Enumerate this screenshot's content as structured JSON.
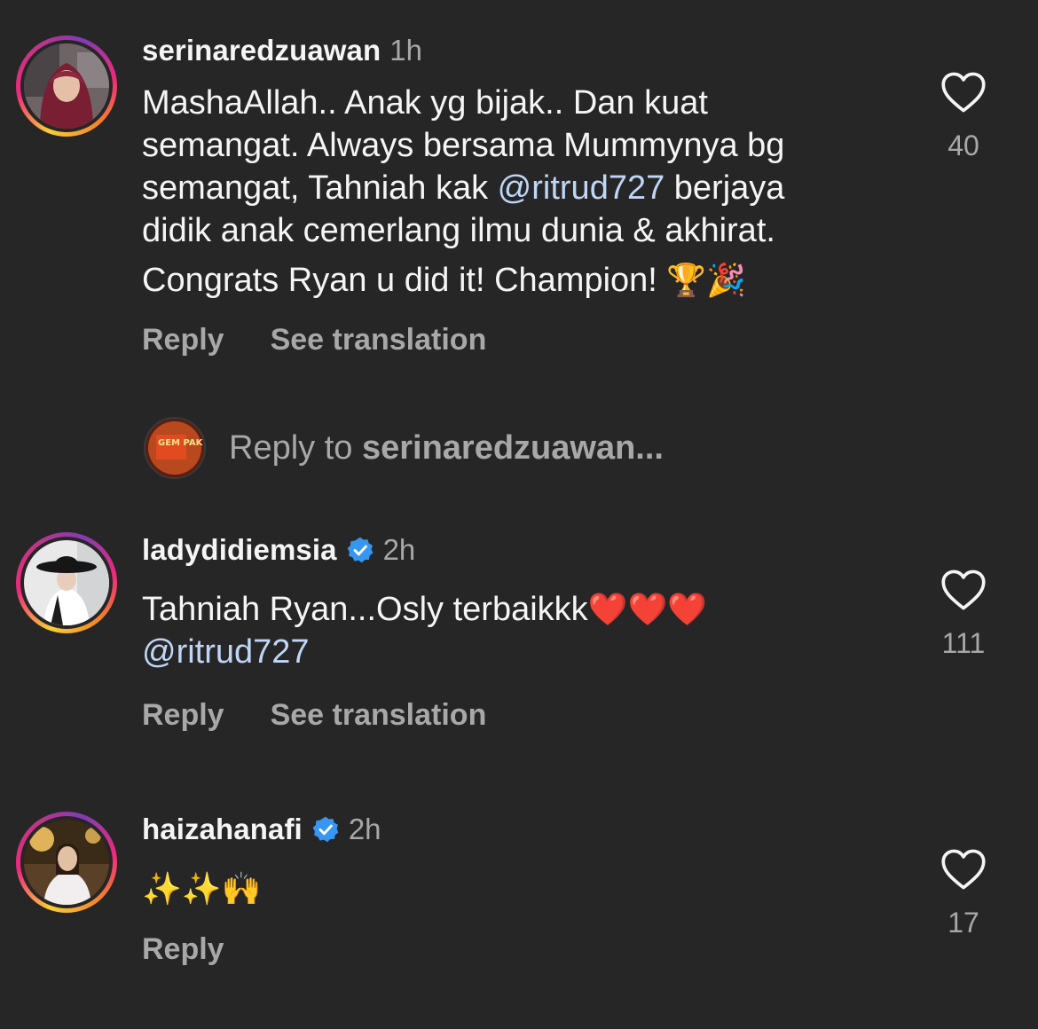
{
  "comments": [
    {
      "username": "serinaredzuawan",
      "verified": false,
      "time": "1h",
      "lines": [
        "MashaAllah.. Anak yg bijak.. Dan kuat",
        "semangat. Always bersama Mummynya bg",
        "semangat, Tahniah kak ",
        "didik anak cemerlang ilmu dunia & akhirat.",
        "Congrats Ryan u did it! Champion! "
      ],
      "mention": "@ritrud727",
      "mention_after": " berjaya",
      "emojis": "🏆🎉",
      "likes": "40",
      "reply_label": "Reply",
      "translate_label": "See translation",
      "avatar_icon": "woman-hijab-avatar"
    },
    {
      "username": "ladydidiemsia",
      "verified": true,
      "time": "2h",
      "line1": "Tahniah Ryan...Osly terbaikkk",
      "hearts": "❤️❤️❤️",
      "mention": "@ritrud727",
      "likes": "111",
      "reply_label": "Reply",
      "translate_label": "See translation",
      "avatar_icon": "woman-hat-avatar"
    },
    {
      "username": "haizahanafi",
      "verified": true,
      "time": "2h",
      "emojis": "✨✨🙌",
      "likes": "17",
      "reply_label": "Reply",
      "avatar_icon": "woman-portrait-avatar"
    }
  ],
  "composer": {
    "prefix": "Reply to ",
    "target": "serinaredzuawan...",
    "avatar_text": "GEM PAK"
  },
  "colors": {
    "background": "#262626",
    "text": "#f5f5f5",
    "muted": "#a8a8a8",
    "mention": "#bfd6f7",
    "verified": "#3797f0"
  }
}
